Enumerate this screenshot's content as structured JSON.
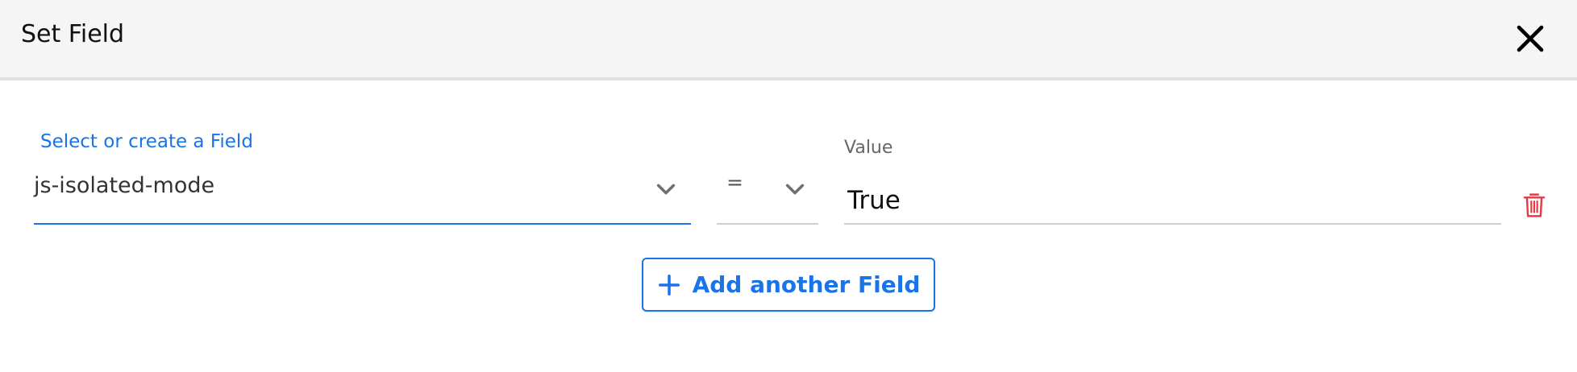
{
  "dialog": {
    "title": "Set Field",
    "close_icon": "close-icon"
  },
  "row": {
    "field_label": "Select or create a Field",
    "field_value": "js-isolated-mode",
    "operator_value": "=",
    "value_label": "Value",
    "value": "True",
    "delete_icon": "trash-icon"
  },
  "actions": {
    "add_label": "Add another Field",
    "add_icon": "plus-icon"
  },
  "colors": {
    "accent": "#1a73e8",
    "delete": "#e53945",
    "header_bg": "#f5f5f5"
  }
}
